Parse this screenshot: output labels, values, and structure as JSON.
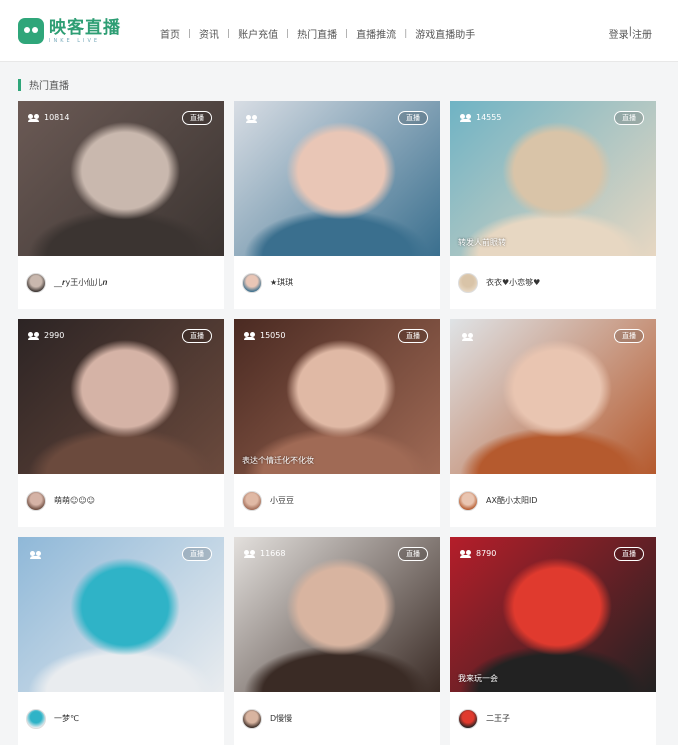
{
  "header": {
    "logo_text": "映客直播",
    "logo_sub": "INKE LIVE",
    "nav": [
      "首页",
      "资讯",
      "账户充值",
      "热门直播",
      "直播推流",
      "游戏直播助手"
    ],
    "nav_sep": "|",
    "login_label": "登录",
    "login_sep": "|",
    "register_label": "注册"
  },
  "section": {
    "title": "热门直播"
  },
  "live_badge": "直播",
  "cards": [
    {
      "viewers": "10814",
      "caption": "",
      "name": "__𝒓y王小仙儿𝒏",
      "colors": [
        "#6b5a55",
        "#c9b8ae",
        "#3b3431"
      ]
    },
    {
      "viewers": "",
      "caption": "",
      "name": "★琪琪",
      "colors": [
        "#d8dde4",
        "#e9c6b6",
        "#3a6f8e"
      ]
    },
    {
      "viewers": "14555",
      "caption": "转发人前眼转",
      "name": "衣衣♥小恋够♥",
      "colors": [
        "#6fb3c4",
        "#d9c4a8",
        "#e7d7c2"
      ]
    },
    {
      "viewers": "2990",
      "caption": "",
      "name": "萌萌☺☺☺",
      "colors": [
        "#2c2424",
        "#d5b3a6",
        "#6b4a3d"
      ]
    },
    {
      "viewers": "15050",
      "caption": "表达个情迁化不化妆",
      "name": "小豆豆",
      "colors": [
        "#4a2a22",
        "#e0b9a5",
        "#a06a55"
      ]
    },
    {
      "viewers": "",
      "caption": "",
      "name": "AX酷小太阳ID",
      "colors": [
        "#dfe3e6",
        "#e9c5b1",
        "#b55a2e"
      ]
    },
    {
      "viewers": "",
      "caption": "",
      "name": "一梦℃",
      "colors": [
        "#8fb8d8",
        "#2fb3c7",
        "#e9ecef"
      ]
    },
    {
      "viewers": "11668",
      "caption": "",
      "name": "D慢慢",
      "colors": [
        "#e3e0dd",
        "#d8b4a0",
        "#3a2b25"
      ]
    },
    {
      "viewers": "8790",
      "caption": "我来玩一会",
      "name": "二王子",
      "colors": [
        "#b51e2a",
        "#e03a2e",
        "#222222"
      ]
    }
  ]
}
